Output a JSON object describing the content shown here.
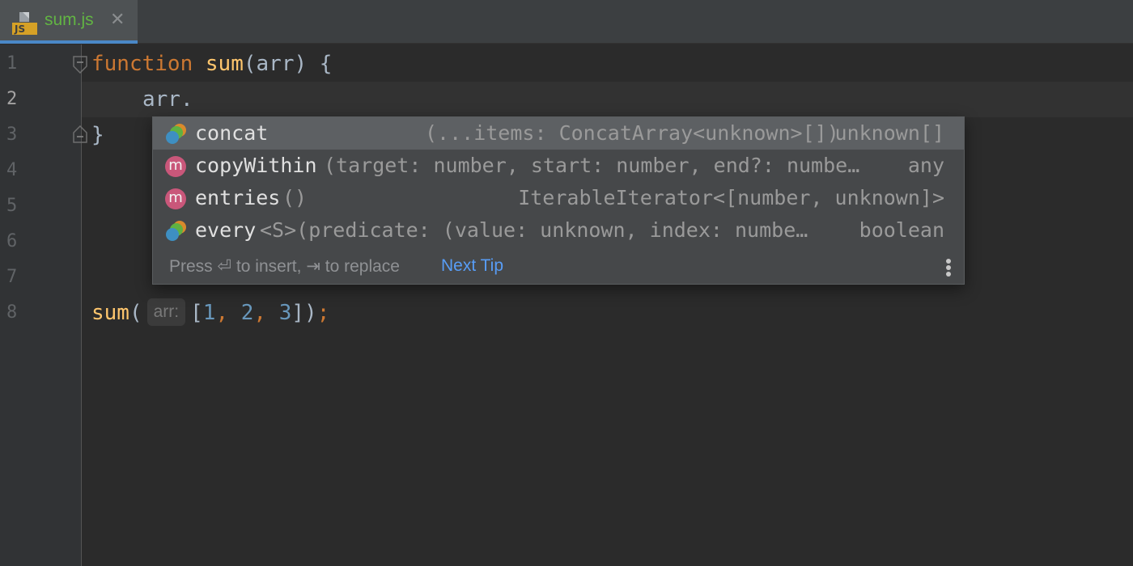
{
  "tab": {
    "label": "sum.js",
    "close": "✕",
    "icon_text": "JS"
  },
  "gutter": {
    "line_numbers": [
      "1",
      "2",
      "3",
      "4",
      "5",
      "6",
      "7",
      "8"
    ]
  },
  "code": {
    "line1": {
      "kw": "function",
      "fn": "sum",
      "rest": "(arr) {"
    },
    "line2": {
      "text": "arr."
    },
    "line3": {
      "text": "}"
    },
    "line8": {
      "fn": "sum",
      "open": "(",
      "hint": "arr:",
      "bracket_open": "[",
      "n1": "1",
      "c1": ",",
      "n2": "2",
      "c2": ",",
      "n3": "3",
      "close": "])",
      "semi": ";"
    }
  },
  "completion": {
    "items": [
      {
        "name": "concat",
        "signature": "(...items: ConcatArray<unknown>[])",
        "type": "unknown[]",
        "icon": "property-icon"
      },
      {
        "name": "copyWithin",
        "signature": "(target: number, start: number, end?: numbe…",
        "type": "any",
        "icon": "m"
      },
      {
        "name": "entries",
        "signature": "()",
        "type": "IterableIterator<[number, unknown]>",
        "icon": "m"
      },
      {
        "name": "every",
        "signature": "<S>(predicate: (value: unknown, index: numbe…",
        "type": "boolean",
        "icon": "property-icon"
      }
    ],
    "footer": {
      "text": "Press ⏎ to insert, ⇥ to replace",
      "next_tip": "Next Tip"
    }
  },
  "colors": {
    "keyword": "#cc7832",
    "function": "#ffc66d",
    "number": "#6897bb",
    "link": "#589df6",
    "tab_label": "#62b543"
  }
}
